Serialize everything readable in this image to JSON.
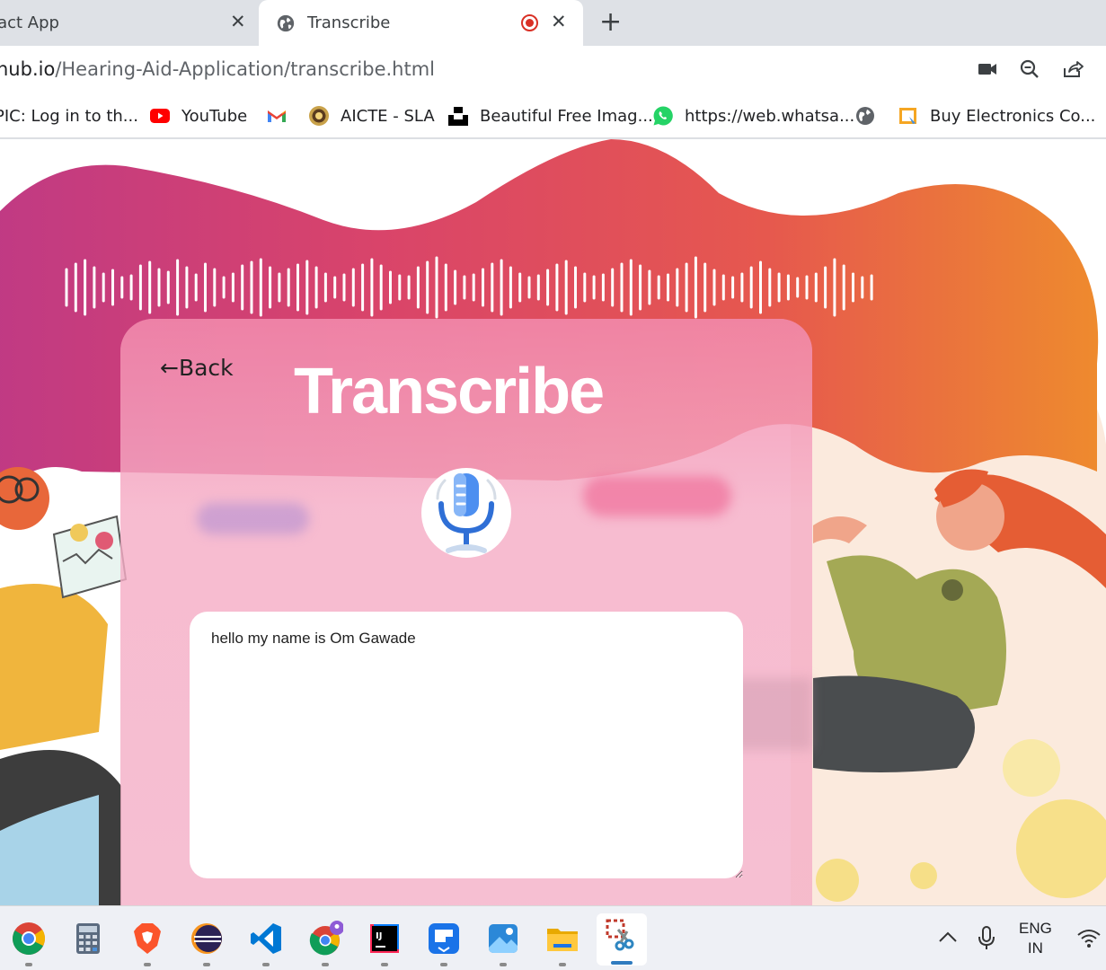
{
  "tabs": [
    {
      "title": "eact App",
      "active": false
    },
    {
      "title": "Transcribe",
      "active": true,
      "recording": true
    }
  ],
  "address": {
    "host": "hub.io",
    "path": "/Hearing-Aid-Application/transcribe.html"
  },
  "bookmarks": [
    {
      "label": "PIC: Log in to th...",
      "icon": "none"
    },
    {
      "label": "YouTube",
      "icon": "youtube-icon"
    },
    {
      "label": "",
      "icon": "gmail-icon"
    },
    {
      "label": "AICTE - SLA",
      "icon": "aicte-icon"
    },
    {
      "label": "Beautiful Free Imag...",
      "icon": "unsplash-icon"
    },
    {
      "label": "https://web.whatsa...",
      "icon": "whatsapp-icon"
    },
    {
      "label": "",
      "icon": "globe-icon"
    },
    {
      "label": "Buy Electronics Co...",
      "icon": "store-icon"
    }
  ],
  "page": {
    "back_label": "Back",
    "title": "Transcribe",
    "transcript": "hello my name is Om Gawade"
  },
  "taskbar": {
    "apps": [
      "chrome",
      "calculator",
      "brave",
      "eclipse",
      "vscode",
      "chrome-profile",
      "intellij",
      "app-blue",
      "photos",
      "file-explorer",
      "snipping-tool"
    ],
    "lang_line1": "ENG",
    "lang_line2": "IN"
  },
  "colors": {
    "record": "#d93025",
    "card_pink": "#f5aac3",
    "wave_start": "#c03a84",
    "wave_end": "#ee8a2e"
  }
}
